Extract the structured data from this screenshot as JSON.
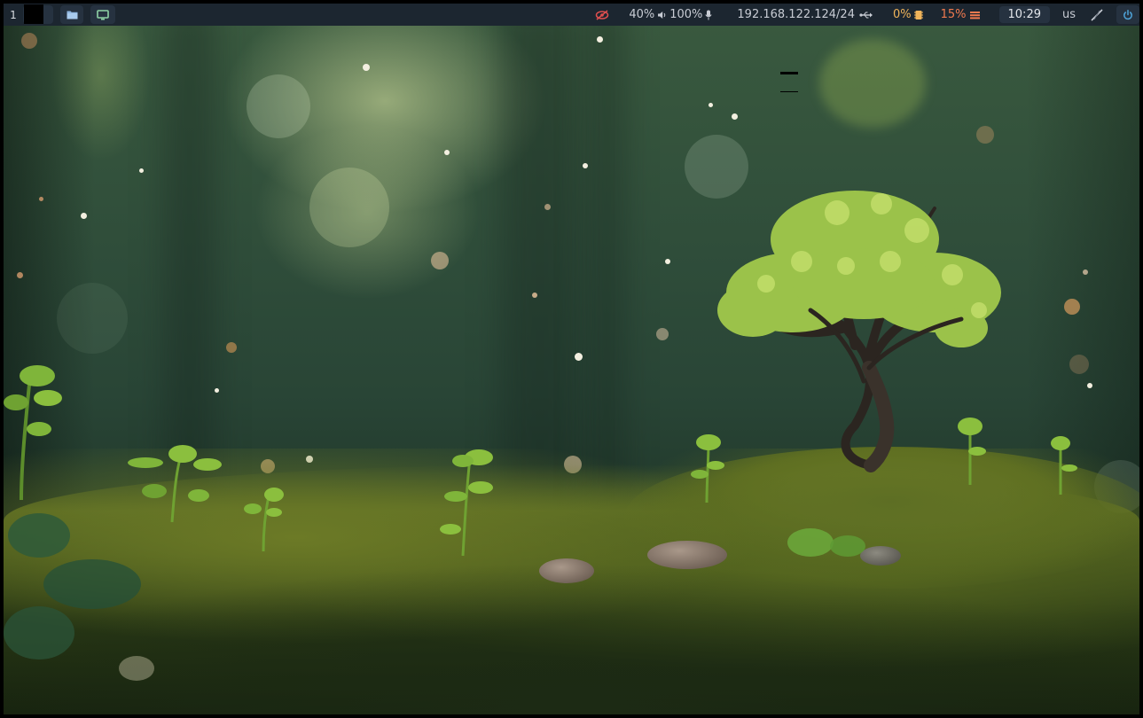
{
  "workspace": {
    "number": "1"
  },
  "launchers": [
    {
      "name": "files",
      "icon": "folder-icon"
    },
    {
      "name": "display",
      "icon": "monitor-icon"
    }
  ],
  "status": {
    "privacy_icon": "eye-slash-icon",
    "volume": "40%",
    "volume_icon": "speaker-icon",
    "microphone": "100%",
    "microphone_icon": "microphone-icon",
    "network": "192.168.122.124/24",
    "network_icon": "ethernet-icon",
    "cpu": "0%",
    "cpu_icon": "cpu-icon",
    "memory": "15%",
    "memory_icon": "memory-icon",
    "clock": "10:29",
    "keyboard_layout": "us",
    "tray_icon": "pen-icon",
    "power_icon": "power-icon"
  },
  "colors": {
    "bar_bg": "#1c2630",
    "pill_bg": "#263240",
    "text": "#c8ccd4",
    "warn": "#f0b45a",
    "alert": "#f07a4f",
    "power": "#4ea3d8",
    "privacy": "#e04f4f"
  }
}
